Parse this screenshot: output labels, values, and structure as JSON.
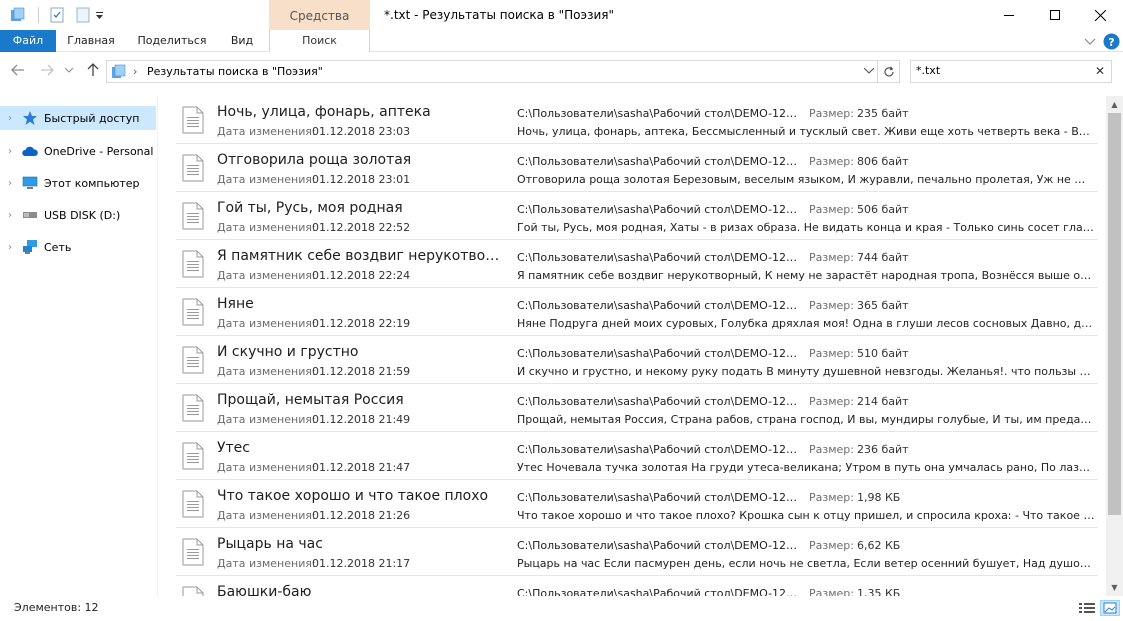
{
  "window": {
    "title": "*.txt - Результаты поиска в \"Поэзия\"",
    "context_tab_header": "Средства поиска"
  },
  "ribbon": {
    "tabs": [
      {
        "label": "Файл"
      },
      {
        "label": "Главная"
      },
      {
        "label": "Поделиться"
      },
      {
        "label": "Вид"
      },
      {
        "label": "Поиск"
      }
    ]
  },
  "address": {
    "breadcrumb": "Результаты поиска в \"Поэзия\"",
    "search_value": "*.txt"
  },
  "nav": {
    "items": [
      {
        "label": "Быстрый доступ",
        "icon": "star-icon",
        "selected": true
      },
      {
        "label": "OneDrive - Personal",
        "icon": "cloud-icon"
      },
      {
        "label": "Этот компьютер",
        "icon": "computer-icon"
      },
      {
        "label": "USB DISK (D:)",
        "icon": "usb-drive-icon"
      },
      {
        "label": "Сеть",
        "icon": "network-icon"
      }
    ]
  },
  "results": {
    "date_label": "Дата изменения:",
    "size_label": "Размер:",
    "items": [
      {
        "name": "Ночь, улица, фонарь, аптека",
        "date": "01.12.2018 23:03",
        "path": "C:\\Пользователи\\sasha\\Рабочий стол\\DEMO-12\\...",
        "size": "235 байт",
        "snippet": "Ночь, улица, фонарь, аптека, Бессмысленный и тусклый свет. Живи еще хоть четверть века - Все буде..."
      },
      {
        "name": "Отговорила роща золотая",
        "date": "01.12.2018 23:01",
        "path": "C:\\Пользователи\\sasha\\Рабочий стол\\DEMO-12\\...",
        "size": "806 байт",
        "snippet": "Отговорила роща золотая Березовым, веселым языком, И журавли, печально пролетая, Уж не жалею..."
      },
      {
        "name": "Гой ты, Русь, моя родная",
        "date": "01.12.2018 22:52",
        "path": "C:\\Пользователи\\sasha\\Рабочий стол\\DEMO-12\\...",
        "size": "506 байт",
        "snippet": "Гой ты, Русь, моя родная, Хаты - в ризах образа. Не видать конца и края - Только синь сосет глаза. Как ..."
      },
      {
        "name": "Я памятник себе воздвиг нерукотворн...",
        "date": "01.12.2018 22:24",
        "path": "C:\\Пользователи\\sasha\\Рабочий стол\\DEMO-12\\...",
        "size": "744 байт",
        "snippet": "Я памятник себе воздвиг нерукотворный, К нему не зарастёт народная тропа, Вознёсся выше он главо..."
      },
      {
        "name": "Няне",
        "date": "01.12.2018 22:19",
        "path": "C:\\Пользователи\\sasha\\Рабочий стол\\DEMO-12\\...",
        "size": "365 байт",
        "snippet": "Няне Подруга дней моих суровых, Голубка дряхлая моя! Одна в глуши лесов сосновых Давно, давно т..."
      },
      {
        "name": "И скучно и грустно",
        "date": "01.12.2018 21:59",
        "path": "C:\\Пользователи\\sasha\\Рабочий стол\\DEMO-12\\...",
        "size": "510 байт",
        "snippet": "И скучно и грустно, и некому руку подать В минуту душевной невзгоды. Желанья!. что пользы напрас..."
      },
      {
        "name": "Прощай, немытая Россия",
        "date": "01.12.2018 21:49",
        "path": "C:\\Пользователи\\sasha\\Рабочий стол\\DEMO-12\\...",
        "size": "214 байт",
        "snippet": "Прощай, немытая Россия, Страна рабов, страна господ, И вы, мундиры голубые, И ты, им преданный ..."
      },
      {
        "name": "Утес",
        "date": "01.12.2018 21:47",
        "path": "C:\\Пользователи\\sasha\\Рабочий стол\\DEMO-12\\...",
        "size": "236 байт",
        "snippet": "Утес Ночевала тучка золотая На груди утеса-великана; Утром в путь она умчалась рано, По лазури вес..."
      },
      {
        "name": "Что такое хорошо и что такое плохо",
        "date": "01.12.2018 21:26",
        "path": "C:\\Пользователи\\sasha\\Рабочий стол\\DEMO-12\\...",
        "size": "1,98 КБ",
        "snippet": "Что такое хорошо и что такое плохо? Крошка сын к отцу пришел, и спросила кроха: - Что такое хоро..."
      },
      {
        "name": "Рыцарь на час",
        "date": "01.12.2018 21:17",
        "path": "C:\\Пользователи\\sasha\\Рабочий стол\\DEMO-12\\...",
        "size": "6,62 КБ",
        "snippet": "Рыцарь на час Если пасмурен день, если ночь не светла, Если ветер осенний бушует, Над душой воца..."
      },
      {
        "name": "Баюшки-баю",
        "date": "",
        "path": "C:\\Пользователи\\sasha\\Рабочий стол\\DEMO-12\\...",
        "size": "1,35 КБ",
        "snippet": ""
      }
    ]
  },
  "status": {
    "count": "Элементов: 12"
  },
  "colors": {
    "file_tab": "#1979ca",
    "context_tab": "#f8dfc9",
    "selection": "#cce8ff"
  }
}
